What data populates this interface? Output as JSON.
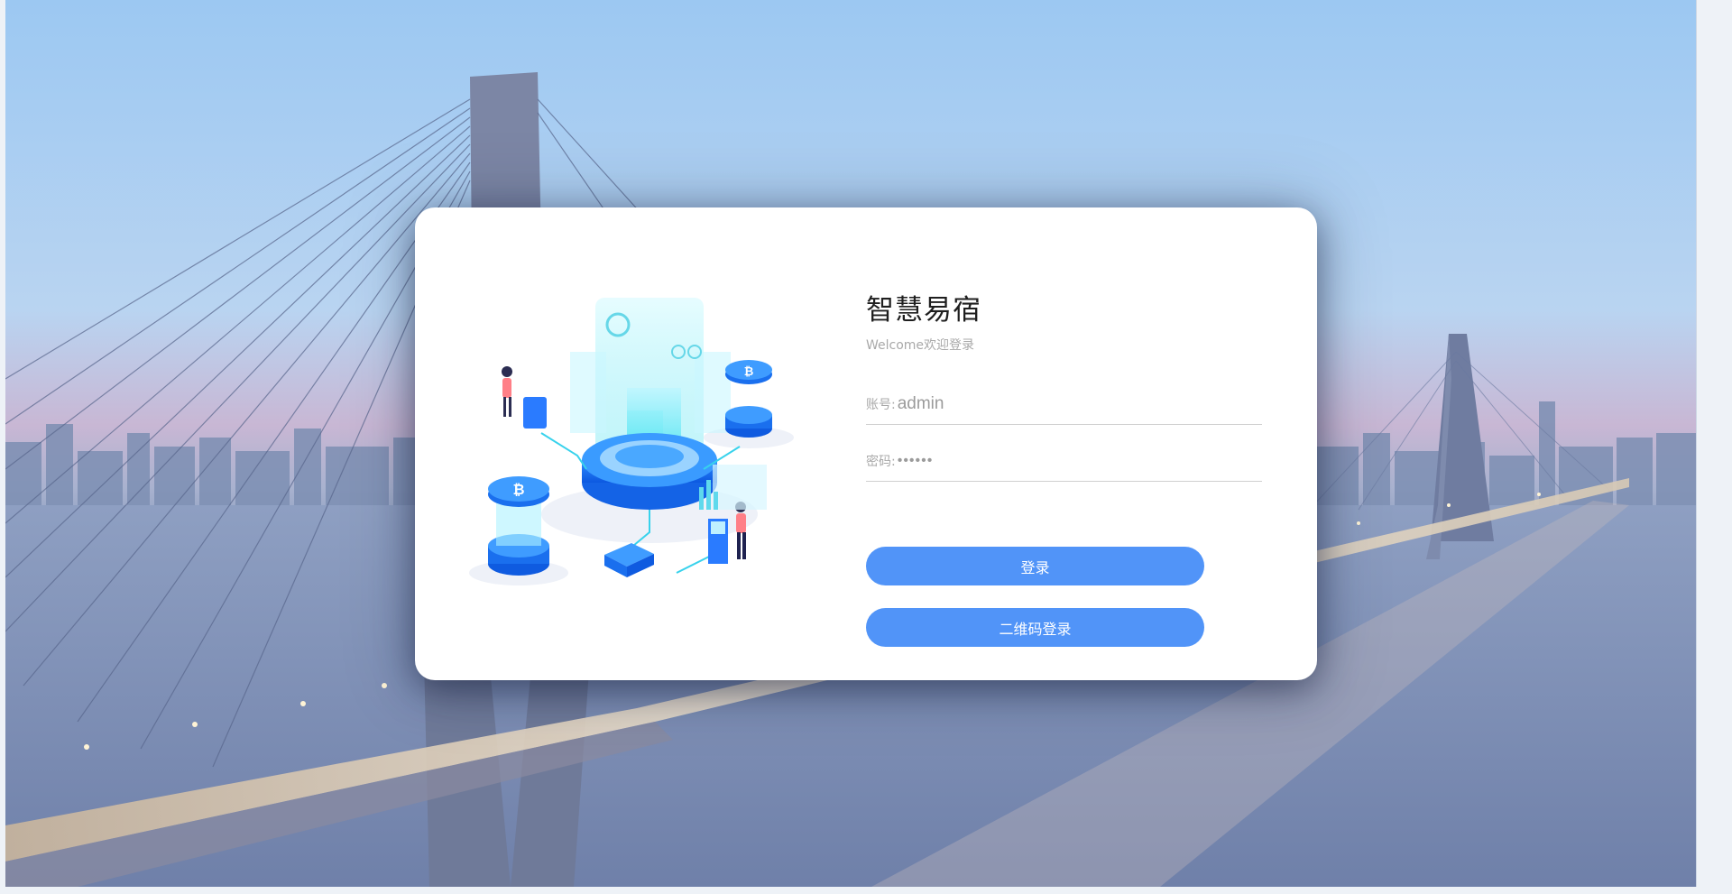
{
  "login": {
    "title": "智慧易宿",
    "subtitle": "Welcome欢迎登录",
    "account_label": "账号:",
    "account_value": "admin",
    "password_label": "密码:",
    "password_value": "••••••",
    "login_button": "登录",
    "qr_login_button": "二维码登录"
  },
  "colors": {
    "primary": "#5194f8",
    "card": "#ffffff",
    "muted_text": "#a9a9a9"
  },
  "icons": {
    "background": "bridge-cityscape-illustration",
    "hero": "isometric-data-center-illustration"
  }
}
